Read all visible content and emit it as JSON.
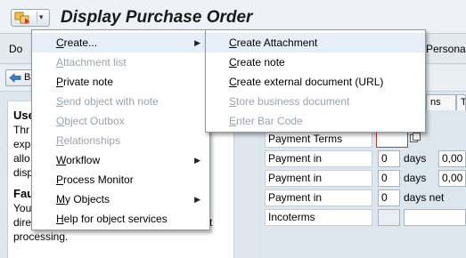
{
  "window": {
    "title": "Display Purchase Order",
    "gos_icon": "services-for-object-icon",
    "gos_arrow": "▾"
  },
  "toolbar": {
    "left_fragment": "Do",
    "right_fragment": "Personal"
  },
  "back_button": {
    "label": "Ba"
  },
  "help_panel": {
    "section1_heading": "Use",
    "section1_lines": [
      "Thr",
      "exp",
      "allo",
      "disp"
    ],
    "section2_heading": "Fau",
    "section2_lines": [
      "You",
      "direct",
      "processing."
    ],
    "section2_tail": "t"
  },
  "tabs": [
    "ns",
    "T"
  ],
  "form": {
    "rows": [
      {
        "label": "Payment Terms"
      },
      {
        "label": "Payment in",
        "value": "0",
        "unit": "days",
        "value2": "0,00"
      },
      {
        "label": "Payment in",
        "value": "0",
        "unit": "days",
        "value2": "0,00"
      },
      {
        "label": "Payment in",
        "value": "0",
        "unit": "days net"
      },
      {
        "label": "Incoterms"
      }
    ]
  },
  "menu": {
    "items": [
      {
        "label": "Create...",
        "mnemonic": "C",
        "rest": "reate...",
        "enabled": true,
        "submenu": true,
        "active": true
      },
      {
        "label": "Attachment list",
        "mnemonic": "A",
        "rest": "ttachment list",
        "enabled": false
      },
      {
        "label": "Private note",
        "mnemonic": "P",
        "rest": "rivate note",
        "enabled": true
      },
      {
        "label": "Send object with note",
        "mnemonic": "S",
        "rest": "end object with note",
        "enabled": false
      },
      {
        "label": "Object Outbox",
        "mnemonic": "O",
        "rest": "bject Outbox",
        "enabled": false
      },
      {
        "label": "Relationships",
        "mnemonic": "R",
        "rest": "elationships",
        "enabled": false
      },
      {
        "label": "Workflow",
        "mnemonic": "W",
        "rest": "orkflow",
        "enabled": true,
        "submenu": true
      },
      {
        "label": "Process Monitor",
        "mnemonic": "P",
        "rest": "rocess Monitor",
        "enabled": true
      },
      {
        "label": "My Objects",
        "mnemonic": "M",
        "rest": "y Objects",
        "enabled": true,
        "submenu": true
      },
      {
        "label": "Help for object services",
        "mnemonic": "H",
        "rest": "elp for object services",
        "enabled": true
      }
    ],
    "submenu_arrow": "▶"
  },
  "create_submenu": {
    "items": [
      {
        "label": "Create Attachment",
        "mnemonic": "C",
        "rest": "reate Attachment",
        "enabled": true
      },
      {
        "label": "Create note",
        "mnemonic": "C",
        "rest": "reate note",
        "enabled": true
      },
      {
        "label": "Create external document (URL)",
        "mnemonic": "C",
        "rest": "reate external document (URL)",
        "enabled": true
      },
      {
        "label": "Store business document",
        "mnemonic": "S",
        "rest": "tore business document",
        "enabled": false
      },
      {
        "label": "Enter Bar Code",
        "mnemonic": "E",
        "rest": "nter Bar Code",
        "enabled": false
      }
    ]
  },
  "colors": {
    "menu_highlight": "#e6eef7",
    "disabled_text": "#9aa3ad",
    "background": "#dfe6ee"
  }
}
